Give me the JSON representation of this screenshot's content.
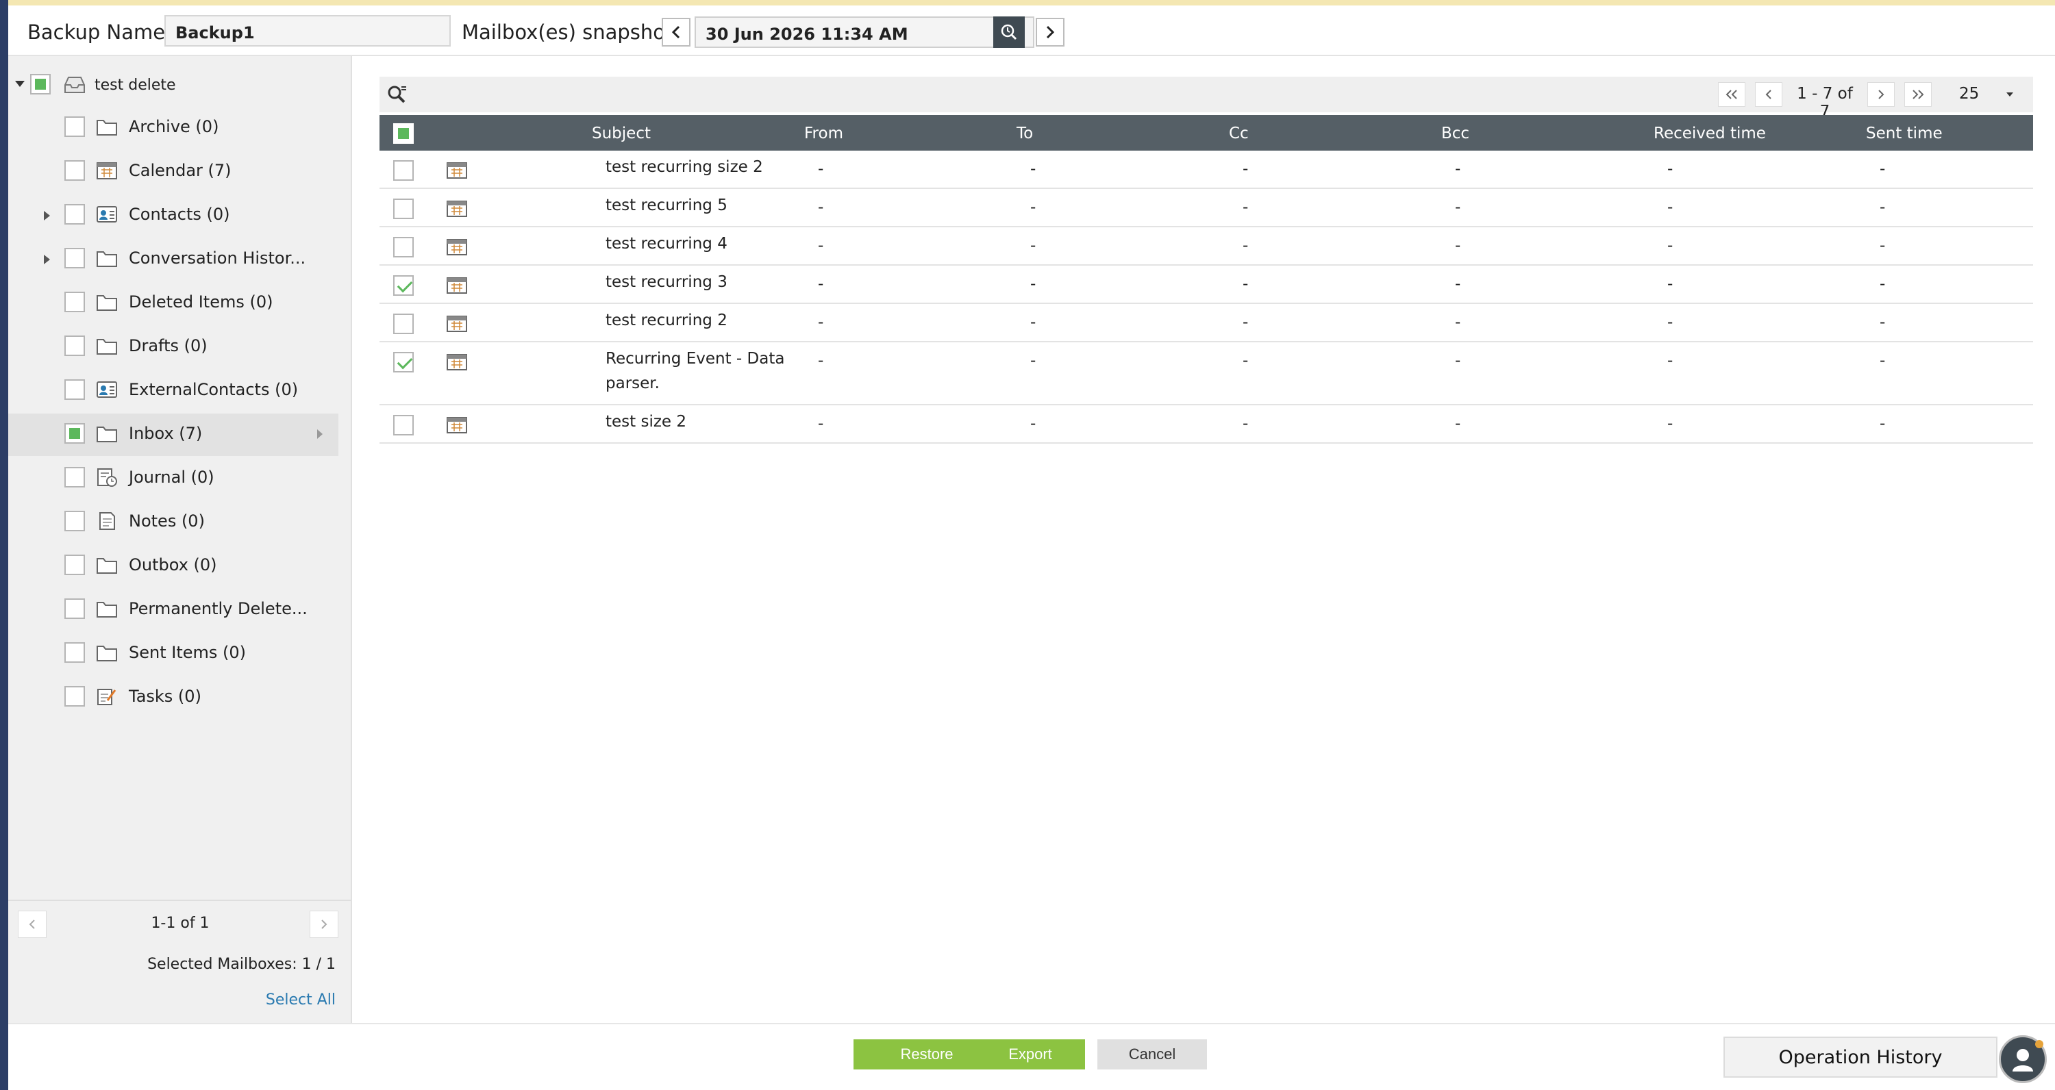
{
  "header": {
    "backup_name_label": "Backup Name",
    "backup_name_value": "Backup1",
    "snapshot_label": "Mailbox(es) snapshot",
    "snapshot_date": "30 Jun 2026 11:34 AM"
  },
  "sidebar": {
    "root_label": "test delete",
    "folders": [
      {
        "label": "Archive (0)",
        "icon": "folder-icon"
      },
      {
        "label": "Calendar (7)",
        "icon": "calendar-icon"
      },
      {
        "label": "Contacts (0)",
        "icon": "contacts-icon"
      },
      {
        "label": "Conversation Histor...",
        "icon": "folder-icon"
      },
      {
        "label": "Deleted Items (0)",
        "icon": "folder-icon"
      },
      {
        "label": "Drafts (0)",
        "icon": "folder-icon"
      },
      {
        "label": "ExternalContacts (0)",
        "icon": "contacts-icon"
      },
      {
        "label": "Inbox (7)",
        "icon": "folder-icon"
      },
      {
        "label": "Journal (0)",
        "icon": "journal-icon"
      },
      {
        "label": "Notes (0)",
        "icon": "notes-icon"
      },
      {
        "label": "Outbox (0)",
        "icon": "folder-icon"
      },
      {
        "label": "Permanently Delete...",
        "icon": "folder-icon"
      },
      {
        "label": "Sent Items (0)",
        "icon": "folder-icon"
      },
      {
        "label": "Tasks (0)",
        "icon": "tasks-icon"
      }
    ],
    "pagination": "1-1 of 1",
    "selected_mailboxes": "Selected Mailboxes:  1 / 1",
    "select_all": "Select All"
  },
  "grid": {
    "pagination": "1 - 7 of 7",
    "page_size": "25",
    "columns": [
      "Subject",
      "From",
      "To",
      "Cc",
      "Bcc",
      "Received time",
      "Sent time"
    ],
    "rows": [
      {
        "subject": "test recurring size 2",
        "checked": false,
        "from": "-",
        "to": "-",
        "cc": "-",
        "bcc": "-",
        "received": "-",
        "sent": "-"
      },
      {
        "subject": "test recurring 5",
        "checked": false,
        "from": "-",
        "to": "-",
        "cc": "-",
        "bcc": "-",
        "received": "-",
        "sent": "-"
      },
      {
        "subject": "test recurring 4",
        "checked": false,
        "from": "-",
        "to": "-",
        "cc": "-",
        "bcc": "-",
        "received": "-",
        "sent": "-"
      },
      {
        "subject": "test recurring 3",
        "checked": true,
        "from": "-",
        "to": "-",
        "cc": "-",
        "bcc": "-",
        "received": "-",
        "sent": "-"
      },
      {
        "subject": "test recurring 2",
        "checked": false,
        "from": "-",
        "to": "-",
        "cc": "-",
        "bcc": "-",
        "received": "-",
        "sent": "-"
      },
      {
        "subject": "Recurring Event - Data parser.",
        "checked": true,
        "from": "-",
        "to": "-",
        "cc": "-",
        "bcc": "-",
        "received": "-",
        "sent": "-"
      },
      {
        "subject": "test size 2",
        "checked": false,
        "from": "-",
        "to": "-",
        "cc": "-",
        "bcc": "-",
        "received": "-",
        "sent": "-"
      }
    ]
  },
  "footer": {
    "restore": "Restore",
    "export": "Export",
    "cancel": "Cancel",
    "operation_history": "Operation History"
  },
  "colors": {
    "accent_green": "#8cc341",
    "header_dark": "#555f66",
    "link_blue": "#2a7ab0"
  }
}
